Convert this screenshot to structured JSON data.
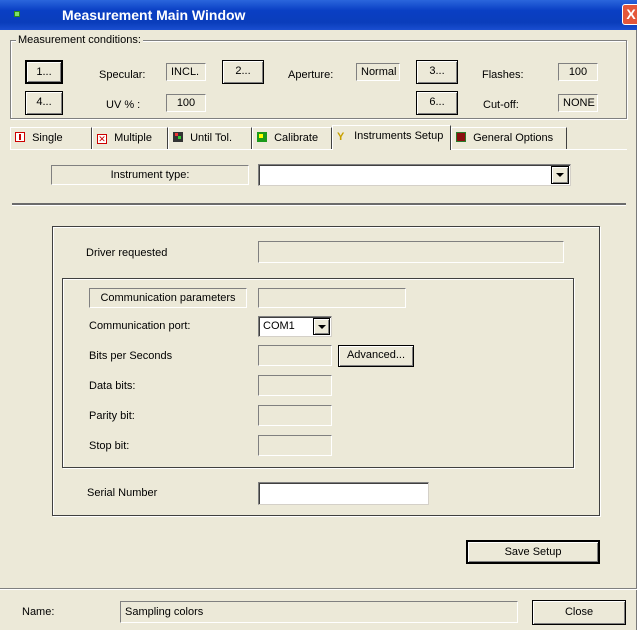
{
  "window": {
    "title": "Measurement Main Window",
    "close_glyph": "X"
  },
  "conditions": {
    "legend": "Measurement conditions:",
    "btn1": "1...",
    "specular_label": "Specular:",
    "specular_value": "INCL.",
    "btn2": "2...",
    "aperture_label": "Aperture:",
    "aperture_value": "Normal",
    "btn3": "3...",
    "flashes_label": "Flashes:",
    "flashes_value": "100",
    "btn4": "4...",
    "uv_label": "UV % :",
    "uv_value": "100",
    "btn6": "6...",
    "cutoff_label": "Cut-off:",
    "cutoff_value": "NONE"
  },
  "tabs": [
    {
      "label": "Single",
      "icon": "single-icon"
    },
    {
      "label": "Multiple",
      "icon": "multiple-icon"
    },
    {
      "label": "Until Tol.",
      "icon": "until-tol-icon"
    },
    {
      "label": "Calibrate",
      "icon": "calibrate-icon"
    },
    {
      "label": "Instruments Setup",
      "icon": "instruments-icon",
      "active": true
    },
    {
      "label": "General Options",
      "icon": "general-options-icon"
    }
  ],
  "instrument": {
    "type_label": "Instrument type:",
    "type_value": ""
  },
  "driver": {
    "label": "Driver requested",
    "value": ""
  },
  "communication": {
    "header_label": "Communication parameters",
    "header_value": "",
    "port_label": "Communication port:",
    "port_value": "COM1",
    "bps_label": "Bits per Seconds",
    "bps_value": "",
    "advanced_label": "Advanced...",
    "databits_label": "Data bits:",
    "databits_value": "",
    "parity_label": "Parity bit:",
    "parity_value": "",
    "stopbit_label": "Stop bit:",
    "stopbit_value": ""
  },
  "serial": {
    "label": "Serial Number",
    "value": ""
  },
  "save_label": "Save Setup",
  "footer": {
    "name_label": "Name:",
    "name_value": "Sampling colors",
    "close_label": "Close"
  }
}
